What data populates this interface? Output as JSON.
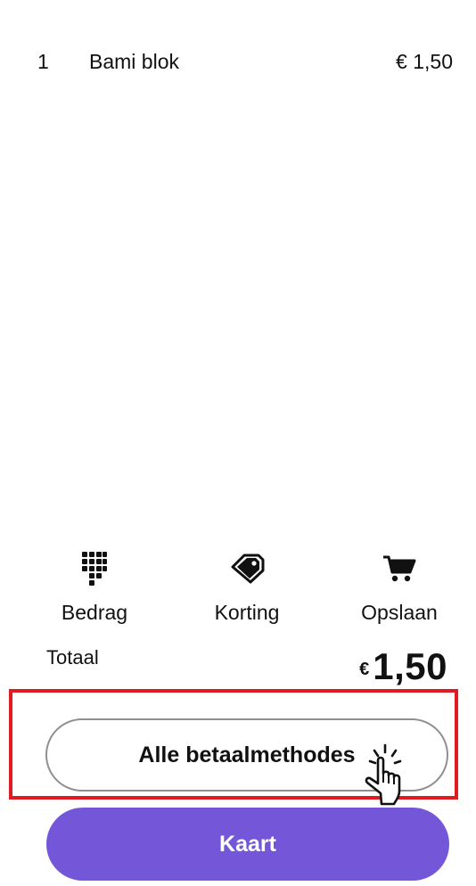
{
  "order": {
    "items": [
      {
        "qty": "1",
        "name": "Bami blok",
        "price": "€ 1,50"
      }
    ]
  },
  "actions": {
    "amount": {
      "label": "Bedrag",
      "icon": "keypad-icon"
    },
    "discount": {
      "label": "Korting",
      "icon": "tag-icon"
    },
    "save": {
      "label": "Opslaan",
      "icon": "cart-icon"
    }
  },
  "total": {
    "label": "Totaal",
    "currency": "€",
    "amount": "1,50"
  },
  "buttons": {
    "all_methods": "Alle betaalmethodes",
    "card": "Kaart"
  },
  "colors": {
    "accent": "#7457d9",
    "highlight": "#e21b23",
    "button_border": "#8f8f8f"
  }
}
